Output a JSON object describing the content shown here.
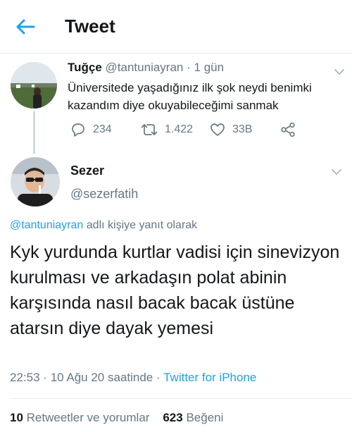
{
  "header": {
    "title": "Tweet",
    "back_icon": "arrow-left-icon",
    "accent": "#1da1f2"
  },
  "original_tweet": {
    "display_name": "Tuğçe",
    "handle": "@tantuniayran",
    "separator": "·",
    "time_ago": "1 gün",
    "text": "Üniversitede yaşadığınız ilk şok neydi benimki kazandım diye okuyabileceğimi sanmak",
    "actions": {
      "replies": "234",
      "retweets": "1.422",
      "likes": "33B"
    }
  },
  "reply_tweet": {
    "display_name": "Sezer",
    "handle": "@sezerfatih",
    "reply_to_handle": "@tantuniayran",
    "reply_to_suffix": "adlı kişiye yanıt olarak",
    "text": "Kyk yurdunda kurtlar vadisi için sinevizyon kurulması ve arkadaşın polat abinin karşısında nasıl bacak bacak üstüne atarsın diye dayak yemesi",
    "time": "22:53",
    "date": "10 Ağu 20 saatinde",
    "separator": "·",
    "source": "Twitter for iPhone"
  },
  "stats": {
    "retweets_count": "10",
    "retweets_label": "Retweetler ve yorumlar",
    "likes_count": "623",
    "likes_label": "Beğeni"
  }
}
